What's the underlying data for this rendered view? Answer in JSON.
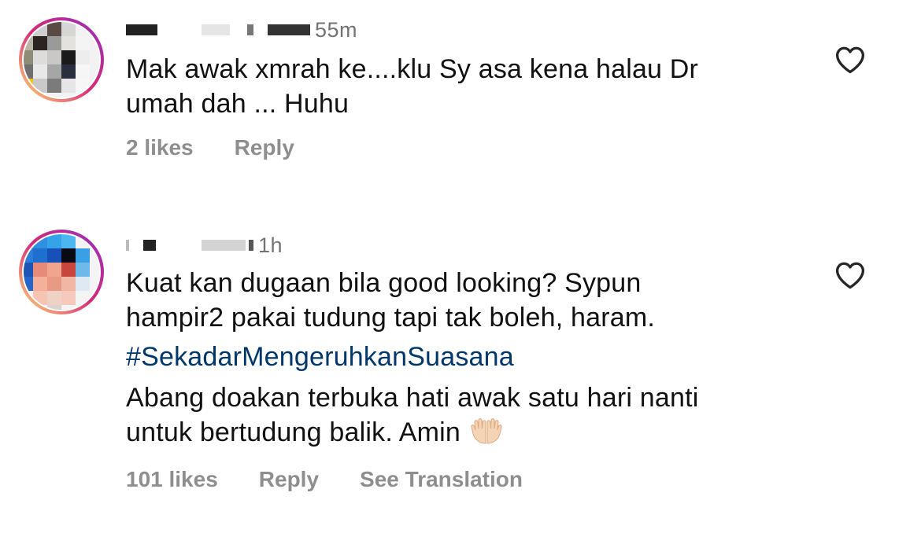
{
  "comments": [
    {
      "time": "55m",
      "lines": [
        "Mak awak xmrah ke....klu Sy asa kena halau Dr",
        "umah dah ... Huhu"
      ],
      "likes": "2 likes",
      "reply": "Reply"
    },
    {
      "time": "1h",
      "lines": [
        "Kuat kan dugaan bila good looking? Sypun",
        "hampir2 pakai tudung tapi tak boleh, haram."
      ],
      "hashtag": "#SekadarMengeruhkanSuasana",
      "lines2": [
        "Abang doakan terbuka hati awak satu hari nanti",
        "untuk bertudung balik. Amin"
      ],
      "emoji": "open-hands-emoji",
      "likes": "101 likes",
      "reply": "Reply",
      "translate": "See Translation"
    }
  ],
  "colors": {
    "text": "#111111",
    "meta": "#737373",
    "action": "#8e8e8e",
    "hashtag": "#00376b",
    "story_ring_start": "#feda75",
    "story_ring_mid": "#d62976",
    "story_ring_end": "#962fbf"
  },
  "icons": {
    "like": "heart-outline-icon"
  }
}
